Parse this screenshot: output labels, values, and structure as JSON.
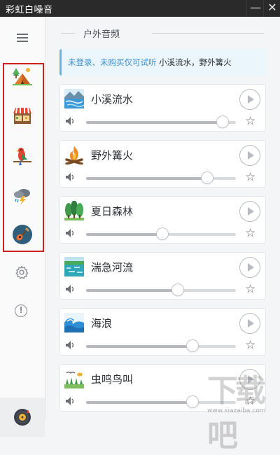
{
  "window": {
    "title": "彩虹白噪音",
    "minimize_glyph": "—",
    "close_glyph": "✕"
  },
  "sidebar": {
    "menu_icon": "hamburger-menu-icon",
    "categories": [
      {
        "id": "outdoor",
        "icon": "camping-tent-icon"
      },
      {
        "id": "market",
        "icon": "market-stall-icon"
      },
      {
        "id": "birds",
        "icon": "parrot-icon"
      },
      {
        "id": "weather",
        "icon": "thunderstorm-cloud-icon"
      },
      {
        "id": "music",
        "icon": "guitar-icon"
      }
    ],
    "settings_icon": "gear-icon",
    "about_label": "!",
    "player_icon": "vinyl-disc-icon"
  },
  "main": {
    "section_title": "户外音频",
    "notice": {
      "prefix": "未登录、未购买仅可试听",
      "sounds": "小溪流水，野外篝火"
    },
    "sounds": [
      {
        "name": "小溪流水",
        "icon": "stream-icon",
        "volume": 0.91
      },
      {
        "name": "野外篝火",
        "icon": "campfire-icon",
        "volume": 0.81
      },
      {
        "name": "夏日森林",
        "icon": "forest-icon",
        "volume": 0.51
      },
      {
        "name": "湍急河流",
        "icon": "river-icon",
        "volume": 0.61
      },
      {
        "name": "海浪",
        "icon": "waves-icon",
        "volume": 0.71
      },
      {
        "name": "虫鸣鸟叫",
        "icon": "insects-birds-icon",
        "volume": 0.71
      }
    ],
    "play_icon": "play-icon",
    "favorite_icon": "star-icon",
    "volume_icon": "speaker-icon"
  },
  "watermark": {
    "logo_text": "下载吧",
    "site": "www.xiazaiba.com"
  },
  "colors": {
    "highlight_border": "#cc2222",
    "notice_bg": "#eaf5fc",
    "notice_accent": "#3d8fd2"
  }
}
